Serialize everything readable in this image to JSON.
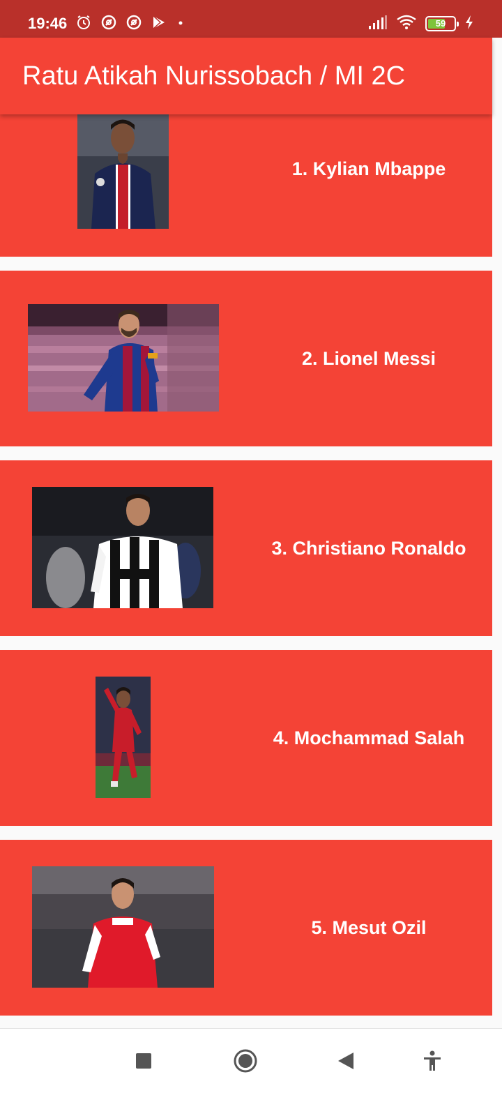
{
  "status_bar": {
    "time": "19:46",
    "battery_level": "59",
    "icons_left": [
      "alarm-icon",
      "data-saver-icon",
      "data-saver-icon",
      "play-store-icon",
      "dot-icon"
    ],
    "icons_right": [
      "signal-icon",
      "wifi-icon",
      "battery-icon",
      "charging-icon"
    ]
  },
  "app_bar": {
    "title": "Ratu Atikah Nurissobach / MI 2C",
    "color": "#f44336"
  },
  "players": [
    {
      "name": "1. Kylian Mbappe",
      "image": "photo-mbappe",
      "kit": "psg"
    },
    {
      "name": "2. Lionel Messi",
      "image": "photo-messi",
      "kit": "barcelona"
    },
    {
      "name": "3. Christiano Ronaldo",
      "image": "photo-ronaldo",
      "kit": "juventus"
    },
    {
      "name": "4. Mochammad Salah",
      "image": "photo-salah",
      "kit": "liverpool"
    },
    {
      "name": "5. Mesut Ozil",
      "image": "photo-ozil",
      "kit": "arsenal"
    }
  ],
  "nav_bar": {
    "buttons": [
      "recents-icon",
      "home-icon",
      "back-icon",
      "accessibility-icon"
    ]
  }
}
